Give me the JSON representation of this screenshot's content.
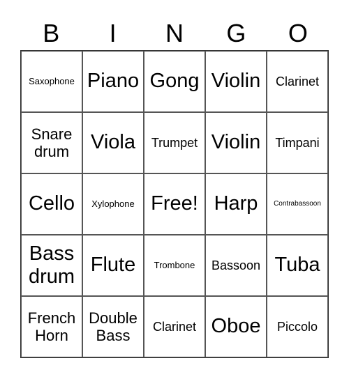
{
  "header": [
    "B",
    "I",
    "N",
    "G",
    "O"
  ],
  "cells": [
    {
      "text": "Saxophone",
      "size": "s-s"
    },
    {
      "text": "Piano",
      "size": "s-xl"
    },
    {
      "text": "Gong",
      "size": "s-xl"
    },
    {
      "text": "Violin",
      "size": "s-xl"
    },
    {
      "text": "Clarinet",
      "size": "s-m"
    },
    {
      "text": "Snare drum",
      "size": "s-l"
    },
    {
      "text": "Viola",
      "size": "s-xl"
    },
    {
      "text": "Trumpet",
      "size": "s-m"
    },
    {
      "text": "Violin",
      "size": "s-xl"
    },
    {
      "text": "Timpani",
      "size": "s-m"
    },
    {
      "text": "Cello",
      "size": "s-xl"
    },
    {
      "text": "Xylophone",
      "size": "s-s"
    },
    {
      "text": "Free!",
      "size": "s-xl"
    },
    {
      "text": "Harp",
      "size": "s-xl"
    },
    {
      "text": "Contrabassoon",
      "size": "s-xs"
    },
    {
      "text": "Bass drum",
      "size": "s-xl"
    },
    {
      "text": "Flute",
      "size": "s-xl"
    },
    {
      "text": "Trombone",
      "size": "s-s"
    },
    {
      "text": "Bassoon",
      "size": "s-m"
    },
    {
      "text": "Tuba",
      "size": "s-xl"
    },
    {
      "text": "French Horn",
      "size": "s-l"
    },
    {
      "text": "Double Bass",
      "size": "s-l"
    },
    {
      "text": "Clarinet",
      "size": "s-m"
    },
    {
      "text": "Oboe",
      "size": "s-xl"
    },
    {
      "text": "Piccolo",
      "size": "s-m"
    }
  ]
}
